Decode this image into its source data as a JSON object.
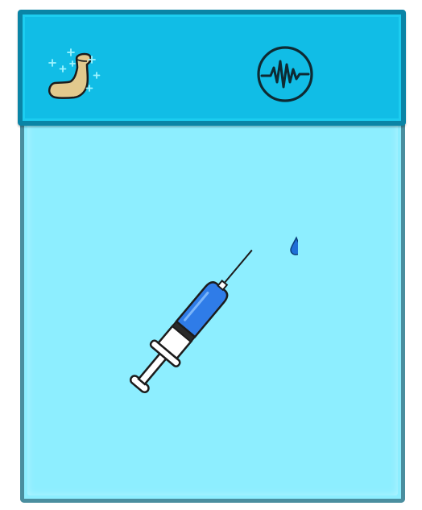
{
  "card": {
    "stats": [
      {
        "icon": "flexed-bicep-icon",
        "meaning": "strength"
      },
      {
        "icon": "heartbeat-pulse-icon",
        "meaning": "health"
      }
    ],
    "item": {
      "icon": "syringe-icon"
    }
  },
  "colors": {
    "header_fill": "#11bde6",
    "header_border": "#0a84a6",
    "body_fill": "#8deeff",
    "body_border": "#4a8e9f",
    "syringe_liquid": "#2f7ce8",
    "droplet": "#1f6fd6",
    "arm": "#e2c98d",
    "sparkle": "#9ff4ff"
  }
}
